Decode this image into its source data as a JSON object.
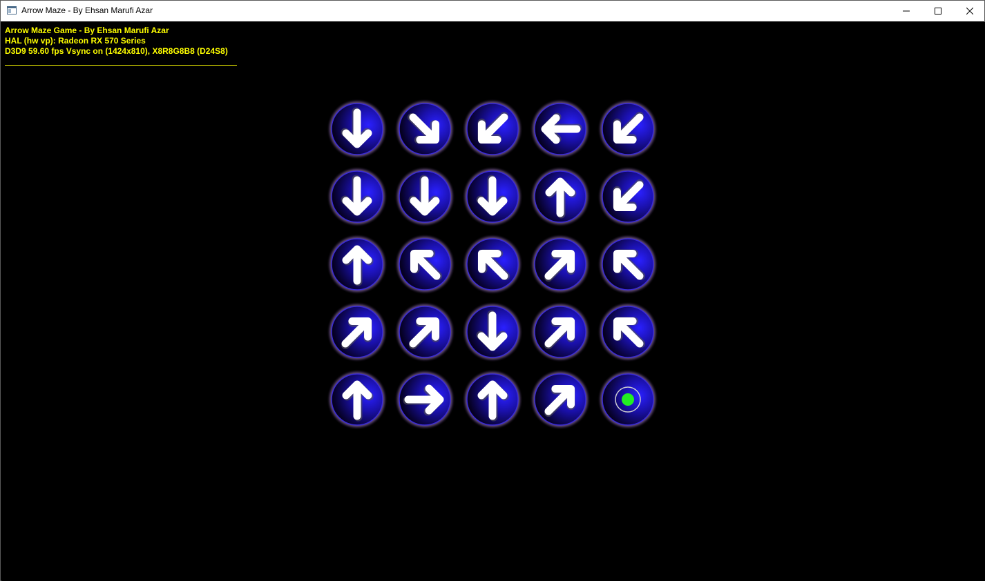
{
  "window": {
    "title": "Arrow Maze - By Ehsan Marufi Azar",
    "buttons": [
      "minimize-icon",
      "maximize-icon",
      "close-icon"
    ]
  },
  "hud": {
    "line1": "Arrow Maze Game - By Ehsan Marufi Azar",
    "line2": "HAL (hw vp): Radeon RX 570 Series",
    "line3": "D3D9 59.60 fps Vsync on (1424x810), X8R8G8B8 (D24S8)",
    "color": "#ffff00"
  },
  "board": {
    "rows": 5,
    "cols": 5,
    "cells": [
      [
        "down",
        "down-right",
        "down-left",
        "left",
        "down-left"
      ],
      [
        "down",
        "down",
        "down",
        "up",
        "down-left"
      ],
      [
        "up",
        "up-left",
        "up-left",
        "up-right",
        "up-left"
      ],
      [
        "up-right",
        "up-right",
        "down",
        "up-right",
        "up-left"
      ],
      [
        "up",
        "right",
        "up",
        "up-right",
        "goal"
      ]
    ],
    "colors": {
      "orb": "#1a10a8",
      "orb_dark": "#050020",
      "glow": "#c7a6e0",
      "arrow": "#ffffff",
      "goal": "#22ee22"
    }
  }
}
